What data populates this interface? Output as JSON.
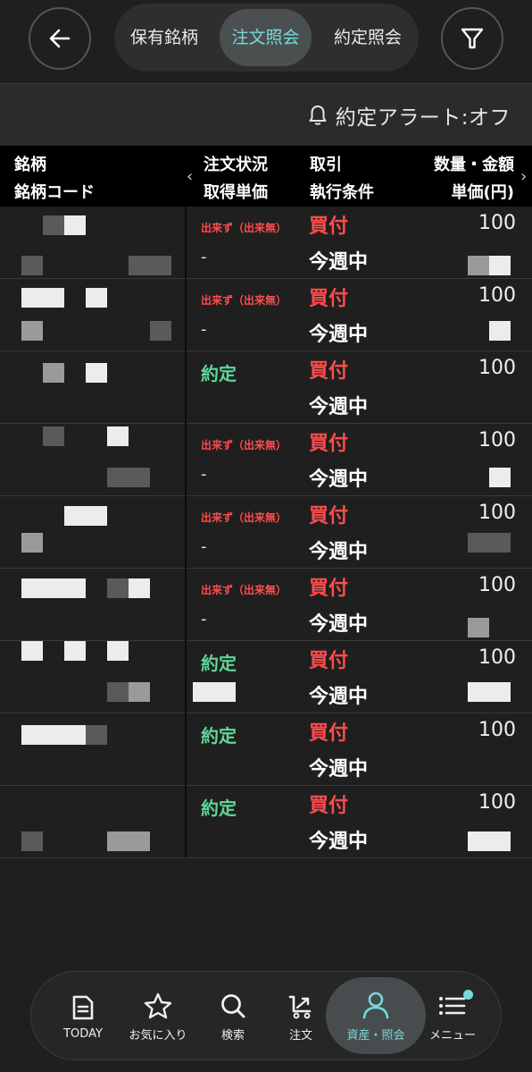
{
  "header": {
    "tabs": [
      "保有銘柄",
      "注文照会",
      "約定照会"
    ],
    "active_tab": 1
  },
  "alert": {
    "text": "約定アラート:オフ"
  },
  "columns": {
    "col1_top": "銘柄",
    "col1_bottom": "銘柄コード",
    "col2_top": "注文状況",
    "col2_bottom": "取得単価",
    "col3_top": "取引",
    "col3_bottom": "執行条件",
    "col4_top": "数量・金額",
    "col4_bottom": "単価(円)"
  },
  "orders": [
    {
      "status": "出来ず（出来無）",
      "status_type": "miss",
      "unit_price": "-",
      "trade": "買付",
      "condition": "今週中",
      "quantity": "100"
    },
    {
      "status": "出来ず（出来無）",
      "status_type": "miss",
      "unit_price": "-",
      "trade": "買付",
      "condition": "今週中",
      "quantity": "100"
    },
    {
      "status": "約定",
      "status_type": "done",
      "unit_price": "",
      "trade": "買付",
      "condition": "今週中",
      "quantity": "100"
    },
    {
      "status": "出来ず（出来無）",
      "status_type": "miss",
      "unit_price": "-",
      "trade": "買付",
      "condition": "今週中",
      "quantity": "100"
    },
    {
      "status": "出来ず（出来無）",
      "status_type": "miss",
      "unit_price": "-",
      "trade": "買付",
      "condition": "今週中",
      "quantity": "100"
    },
    {
      "status": "出来ず（出来無）",
      "status_type": "miss",
      "unit_price": "-",
      "trade": "買付",
      "condition": "今週中",
      "quantity": "100"
    },
    {
      "status": "約定",
      "status_type": "done",
      "unit_price": "",
      "trade": "買付",
      "condition": "今週中",
      "quantity": "100"
    },
    {
      "status": "約定",
      "status_type": "done",
      "unit_price": "",
      "trade": "買付",
      "condition": "今週中",
      "quantity": "100"
    },
    {
      "status": "約定",
      "status_type": "done",
      "unit_price": "",
      "trade": "買付",
      "condition": "今週中",
      "quantity": "100"
    }
  ],
  "nav": {
    "items": [
      {
        "label": "TODAY",
        "icon": "document-icon"
      },
      {
        "label": "お気に入り",
        "icon": "star-icon"
      },
      {
        "label": "検索",
        "icon": "search-icon"
      },
      {
        "label": "注文",
        "icon": "cart-icon"
      },
      {
        "label": "資産・照会",
        "icon": "person-icon"
      },
      {
        "label": "メニュー",
        "icon": "menu-icon"
      }
    ],
    "active_index": 4
  },
  "colors": {
    "accent": "#79d9dc",
    "buy_red": "#ff4b4b",
    "filled_green": "#5ed69a"
  }
}
